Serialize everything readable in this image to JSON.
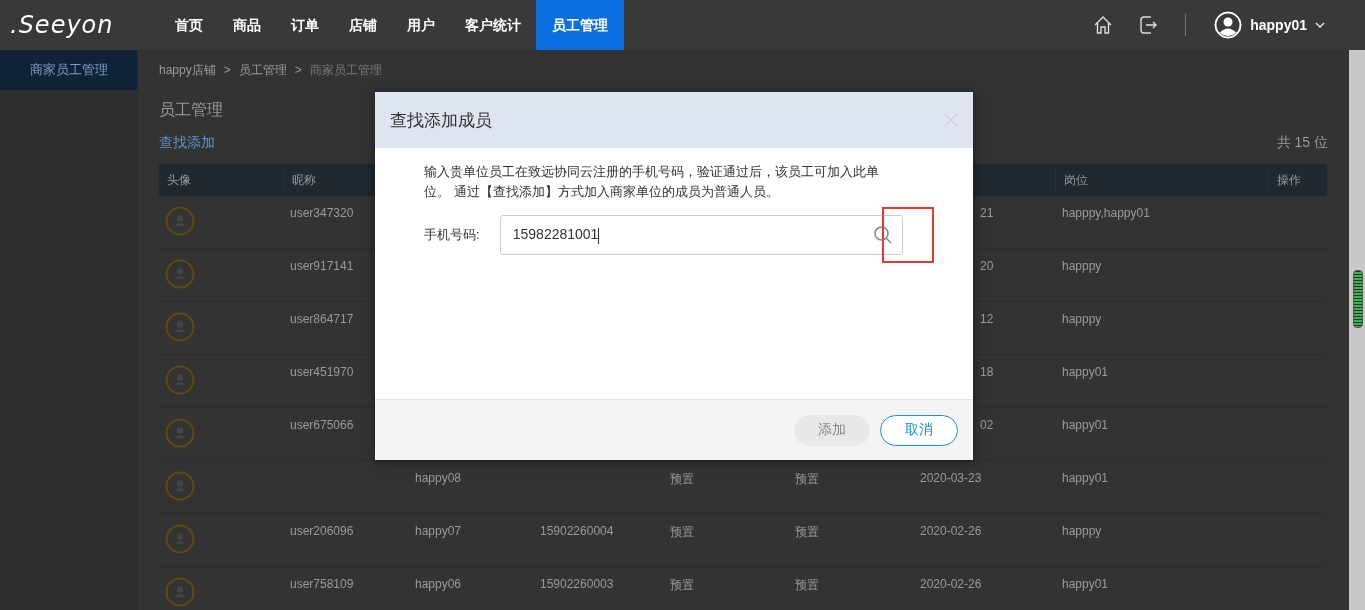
{
  "logo": ".Seeyon",
  "nav": [
    {
      "label": "首页",
      "selected": false
    },
    {
      "label": "商品",
      "selected": false
    },
    {
      "label": "订单",
      "selected": false
    },
    {
      "label": "店铺",
      "selected": false
    },
    {
      "label": "用户",
      "selected": false
    },
    {
      "label": "客户统计",
      "selected": false
    },
    {
      "label": "员工管理",
      "selected": true
    }
  ],
  "user": {
    "name": "happy01"
  },
  "sidebar": {
    "items": [
      {
        "label": "商家员工管理",
        "selected": true
      }
    ]
  },
  "breadcrumb": [
    {
      "label": "happy店铺"
    },
    {
      "separator": ">",
      "label": "员工管理"
    },
    {
      "separator": ">",
      "label": "商家员工管理"
    }
  ],
  "page_title": "员工管理",
  "add_link": "查找添加",
  "total": "共 15 位",
  "table": {
    "columns": [
      "头像",
      "昵称",
      "",
      "",
      "",
      "",
      "",
      "岗位",
      "操作"
    ],
    "rows": [
      {
        "nickname": "user347320",
        "date": "21",
        "position": "happpy,happy01"
      },
      {
        "nickname": "user917141",
        "date": "20",
        "position": "happpy"
      },
      {
        "nickname": "user864717",
        "date": "12",
        "position": "happpy"
      },
      {
        "nickname": "user451970",
        "date": "18",
        "position": "happy01"
      },
      {
        "nickname": "user675066",
        "date": "02",
        "position": "happy01"
      },
      {
        "name": "happy08",
        "type": "预置",
        "role": "预置",
        "date": "2020-03-23",
        "position": "happy01"
      },
      {
        "nickname": "user206096",
        "name": "happy07",
        "phone": "15902260004",
        "type": "预置",
        "role": "预置",
        "date": "2020-02-26",
        "position": "happpy"
      },
      {
        "nickname": "user758109",
        "name": "happy06",
        "phone": "15902260003",
        "type": "预置",
        "role": "预置",
        "date": "2020-02-26",
        "position": "happy01"
      }
    ]
  },
  "dialog": {
    "title": "查找添加成员",
    "description": "输入贵单位员工在致远协同云注册的手机号码，验证通过后，该员工可加入此单位。 通过【查找添加】方式加入商家单位的成员为普通人员。",
    "phone_label": "手机号码:",
    "phone_value": "15982281001",
    "search_highlighted": true,
    "buttons": [
      {
        "label": "添加",
        "kind": "primary",
        "disabled": true
      },
      {
        "label": "取消",
        "kind": "secondary",
        "disabled": false
      }
    ]
  }
}
